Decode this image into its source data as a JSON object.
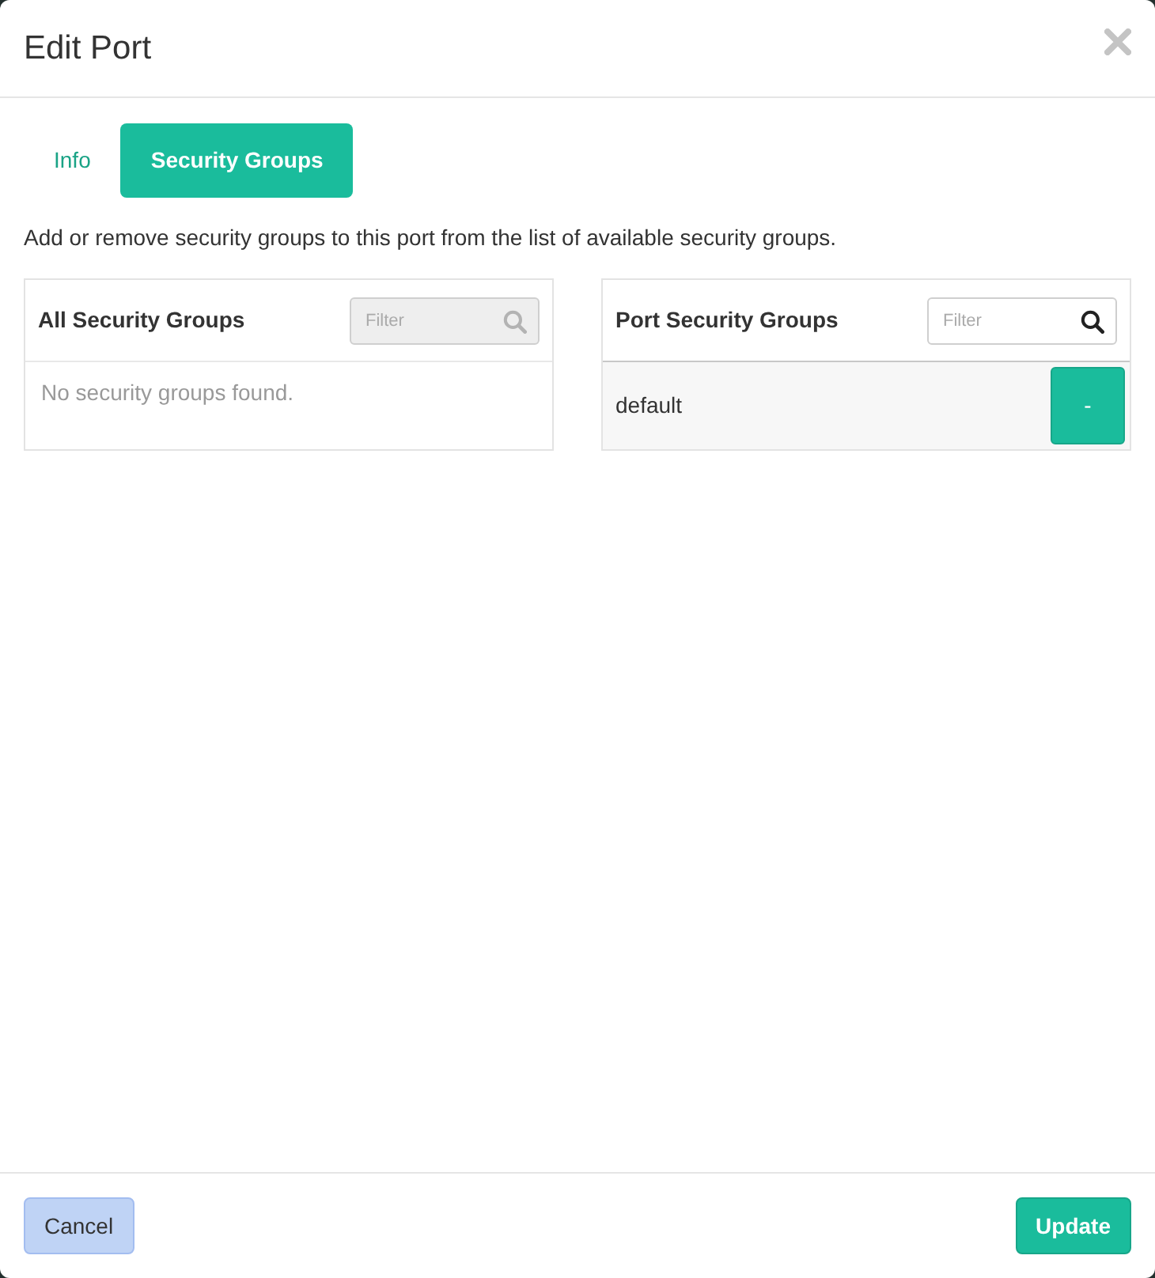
{
  "window": {
    "title": "Edit Port"
  },
  "tabs": [
    {
      "label": "Info",
      "selected": false
    },
    {
      "label": "Security Groups",
      "selected": true
    }
  ],
  "description": "Add or remove security groups to this port from the list of available security groups.",
  "panels": [
    {
      "title": "All Security Groups",
      "filter": {
        "placeholder": "Filter",
        "disabled": true
      },
      "empty_message": "No security groups found."
    },
    {
      "title": "Port Security Groups",
      "filter": {
        "placeholder": "Filter",
        "disabled": false
      },
      "items": [
        {
          "name": "default",
          "button": "-"
        }
      ]
    }
  ],
  "footer": {
    "buttons": [
      {
        "label": "Cancel",
        "kind": "secondary"
      },
      {
        "label": "Update",
        "kind": "primary"
      }
    ]
  }
}
